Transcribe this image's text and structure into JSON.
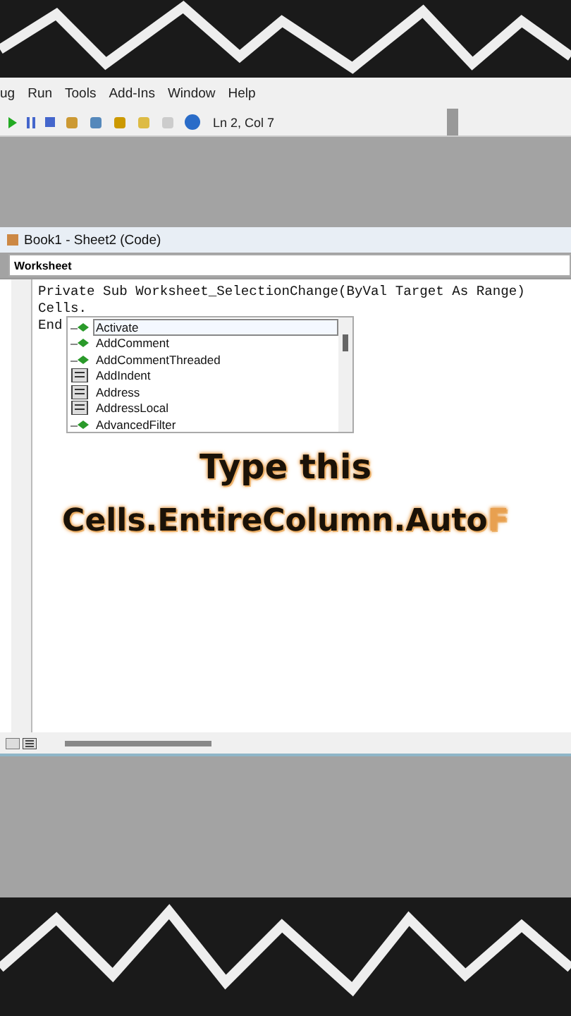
{
  "menu": [
    "ug",
    "Run",
    "Tools",
    "Add-Ins",
    "Window",
    "Help"
  ],
  "toolbar": {
    "position": "Ln 2, Col 7"
  },
  "code_window": {
    "title": "Book1 - Sheet2 (Code)",
    "object_dropdown": "Worksheet",
    "lines": [
      "Private Sub Worksheet_SelectionChange(ByVal Target As Range)",
      "Cells.",
      "End"
    ],
    "completion_list": [
      {
        "label": "Activate",
        "kind": "method",
        "selected": true
      },
      {
        "label": "AddComment",
        "kind": "method",
        "selected": false
      },
      {
        "label": "AddCommentThreaded",
        "kind": "method",
        "selected": false
      },
      {
        "label": "AddIndent",
        "kind": "property",
        "selected": false
      },
      {
        "label": "Address",
        "kind": "property",
        "selected": false
      },
      {
        "label": "AddressLocal",
        "kind": "property",
        "selected": false
      },
      {
        "label": "AdvancedFilter",
        "kind": "method",
        "selected": false
      }
    ]
  },
  "overlay": {
    "heading": "Type this",
    "typed": "Cells.EntireColumn.Auto",
    "next": "F"
  }
}
